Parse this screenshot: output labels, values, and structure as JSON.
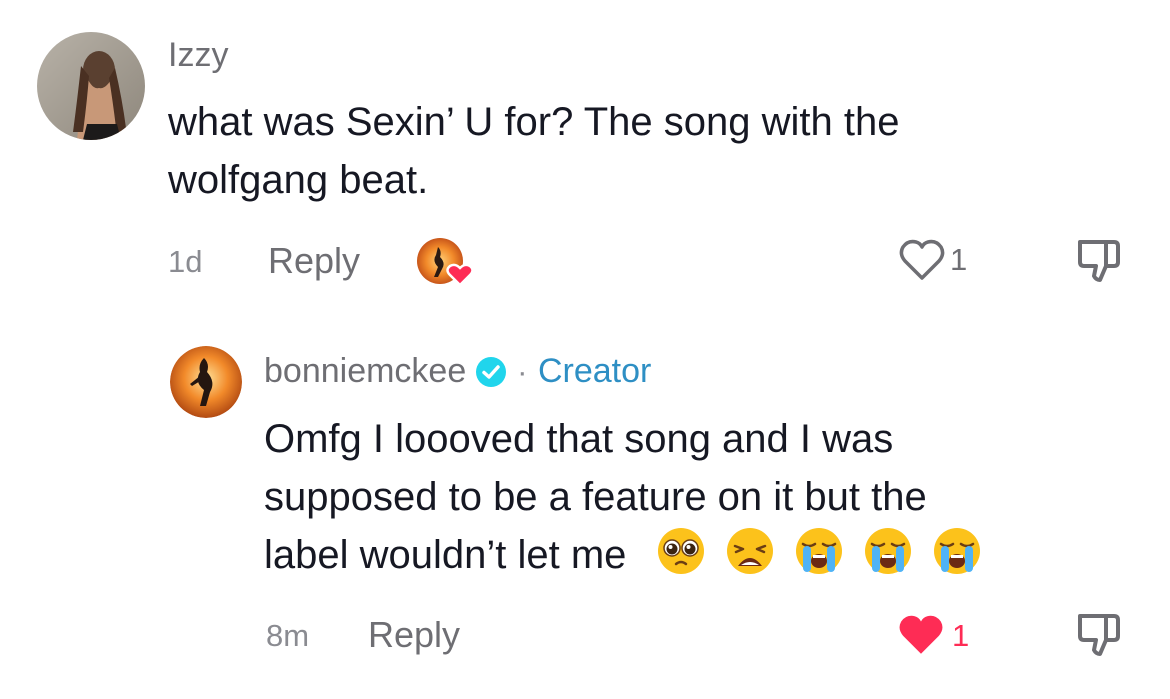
{
  "comments": [
    {
      "username": "Izzy",
      "text_lines": [
        "what was Sexin’ U for? The song with the",
        "wolfgang beat."
      ],
      "time": "1d",
      "reply_label": "Reply",
      "like_count": "1",
      "liked": false,
      "creator_liked": true
    }
  ],
  "reply": {
    "username": "bonniemckee",
    "verified": true,
    "separator": "·",
    "badge": "Creator",
    "text_lines": [
      "Omfg I loooved that song and I was",
      "supposed to be a feature on it but the",
      "label wouldn’t let me"
    ],
    "emojis": [
      "pleading-face",
      "weary-face",
      "loudly-crying-face",
      "loudly-crying-face",
      "loudly-crying-face"
    ],
    "time": "8m",
    "reply_label": "Reply",
    "like_count": "1",
    "liked": true
  },
  "colors": {
    "like_active": "#fe2c55",
    "verified": "#20d5ec",
    "creator": "#2e8fc4",
    "muted": "#8a8b91"
  }
}
